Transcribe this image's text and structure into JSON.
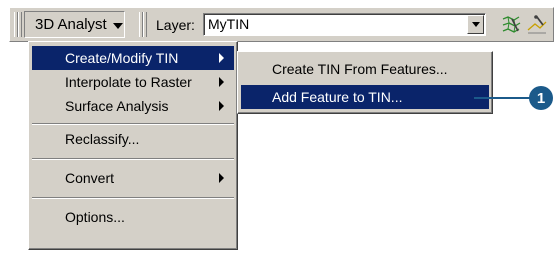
{
  "toolbar": {
    "analyst_label": "3D Analyst",
    "layer_label": "Layer:",
    "layer_value": "MyTIN",
    "icons": [
      "tin-tool-icon",
      "surface-tool-icon"
    ]
  },
  "menu": {
    "items": [
      {
        "label": "Create/Modify TIN",
        "submenu": true,
        "highlighted": true
      },
      {
        "label": "Interpolate to Raster",
        "submenu": true
      },
      {
        "label": "Surface Analysis",
        "submenu": true
      },
      {
        "label": "Reclassify..."
      },
      {
        "label": "Convert",
        "submenu": true
      },
      {
        "label": "Options..."
      }
    ]
  },
  "submenu": {
    "items": [
      {
        "label": "Create TIN From Features..."
      },
      {
        "label": "Add Feature to TIN...",
        "highlighted": true
      }
    ]
  },
  "callout": {
    "number": "1",
    "color": "#1b5a8a"
  },
  "colors": {
    "highlight": "#0a246a",
    "menu_bg": "#d4d0c8"
  }
}
